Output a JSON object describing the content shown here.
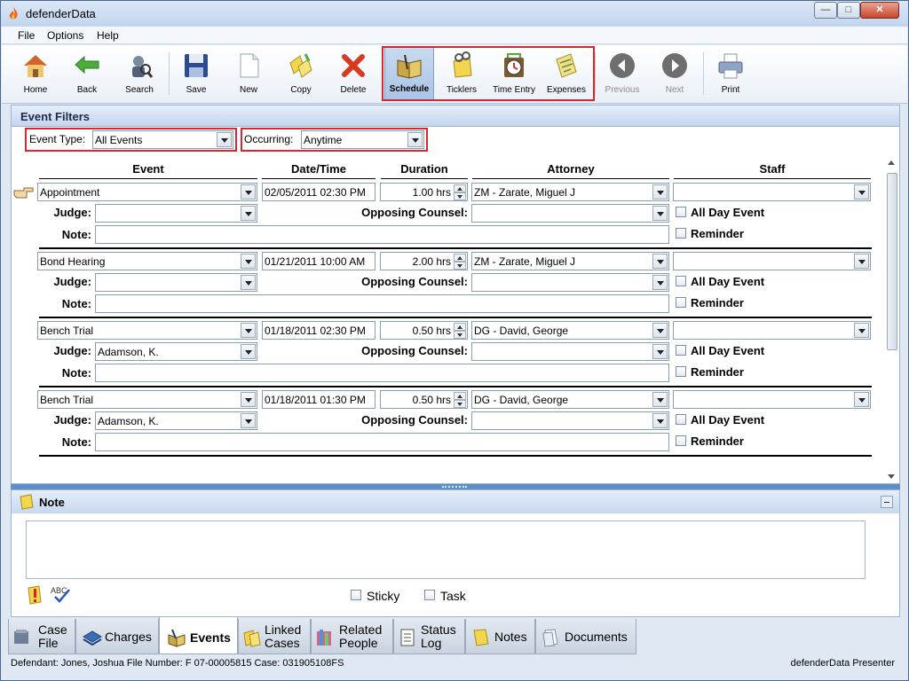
{
  "window": {
    "title": "defenderData"
  },
  "menu": [
    "File",
    "Options",
    "Help"
  ],
  "toolbar": {
    "home": "Home",
    "back": "Back",
    "search": "Search",
    "save": "Save",
    "new": "New",
    "copy": "Copy",
    "delete": "Delete",
    "schedule": "Schedule",
    "ticklers": "Ticklers",
    "time_entry": "Time Entry",
    "expenses": "Expenses",
    "previous": "Previous",
    "next": "Next",
    "print": "Print"
  },
  "filters": {
    "title": "Event Filters",
    "event_type_label": "Event Type:",
    "event_type_value": "All Events",
    "occurring_label": "Occurring:",
    "occurring_value": "Anytime"
  },
  "columns": {
    "event": "Event",
    "datetime": "Date/Time",
    "duration": "Duration",
    "attorney": "Attorney",
    "staff": "Staff"
  },
  "labels": {
    "judge": "Judge:",
    "opposing": "Opposing Counsel:",
    "note": "Note:",
    "all_day": "All Day Event",
    "reminder": "Reminder"
  },
  "events": [
    {
      "event": "Appointment",
      "datetime": "02/05/2011 02:30 PM",
      "duration": "1.00 hrs",
      "attorney": "ZM - Zarate, Miguel J",
      "staff": "",
      "judge": "",
      "opposing": "",
      "note": ""
    },
    {
      "event": "Bond Hearing",
      "datetime": "01/21/2011 10:00 AM",
      "duration": "2.00 hrs",
      "attorney": "ZM - Zarate, Miguel J",
      "staff": "",
      "judge": "",
      "opposing": "",
      "note": ""
    },
    {
      "event": "Bench Trial",
      "datetime": "01/18/2011 02:30 PM",
      "duration": "0.50 hrs",
      "attorney": "DG - David, George",
      "staff": "",
      "judge": "Adamson, K.",
      "opposing": "",
      "note": ""
    },
    {
      "event": "Bench Trial",
      "datetime": "01/18/2011 01:30 PM",
      "duration": "0.50 hrs",
      "attorney": "DG - David, George",
      "staff": "",
      "judge": "Adamson, K.",
      "opposing": "",
      "note": ""
    }
  ],
  "note_panel": {
    "title": "Note",
    "sticky": "Sticky",
    "task": "Task"
  },
  "tabs": {
    "case_file_1": "Case",
    "case_file_2": "File",
    "charges": "Charges",
    "events": "Events",
    "linked_1": "Linked",
    "linked_2": "Cases",
    "related_1": "Related",
    "related_2": "People",
    "status_1": "Status",
    "status_2": "Log",
    "notes": "Notes",
    "documents": "Documents"
  },
  "status": {
    "left": "Defendant: Jones, Joshua  File Number: F  07-00005815  Case: 031905108FS",
    "right": "defenderData Presenter"
  }
}
